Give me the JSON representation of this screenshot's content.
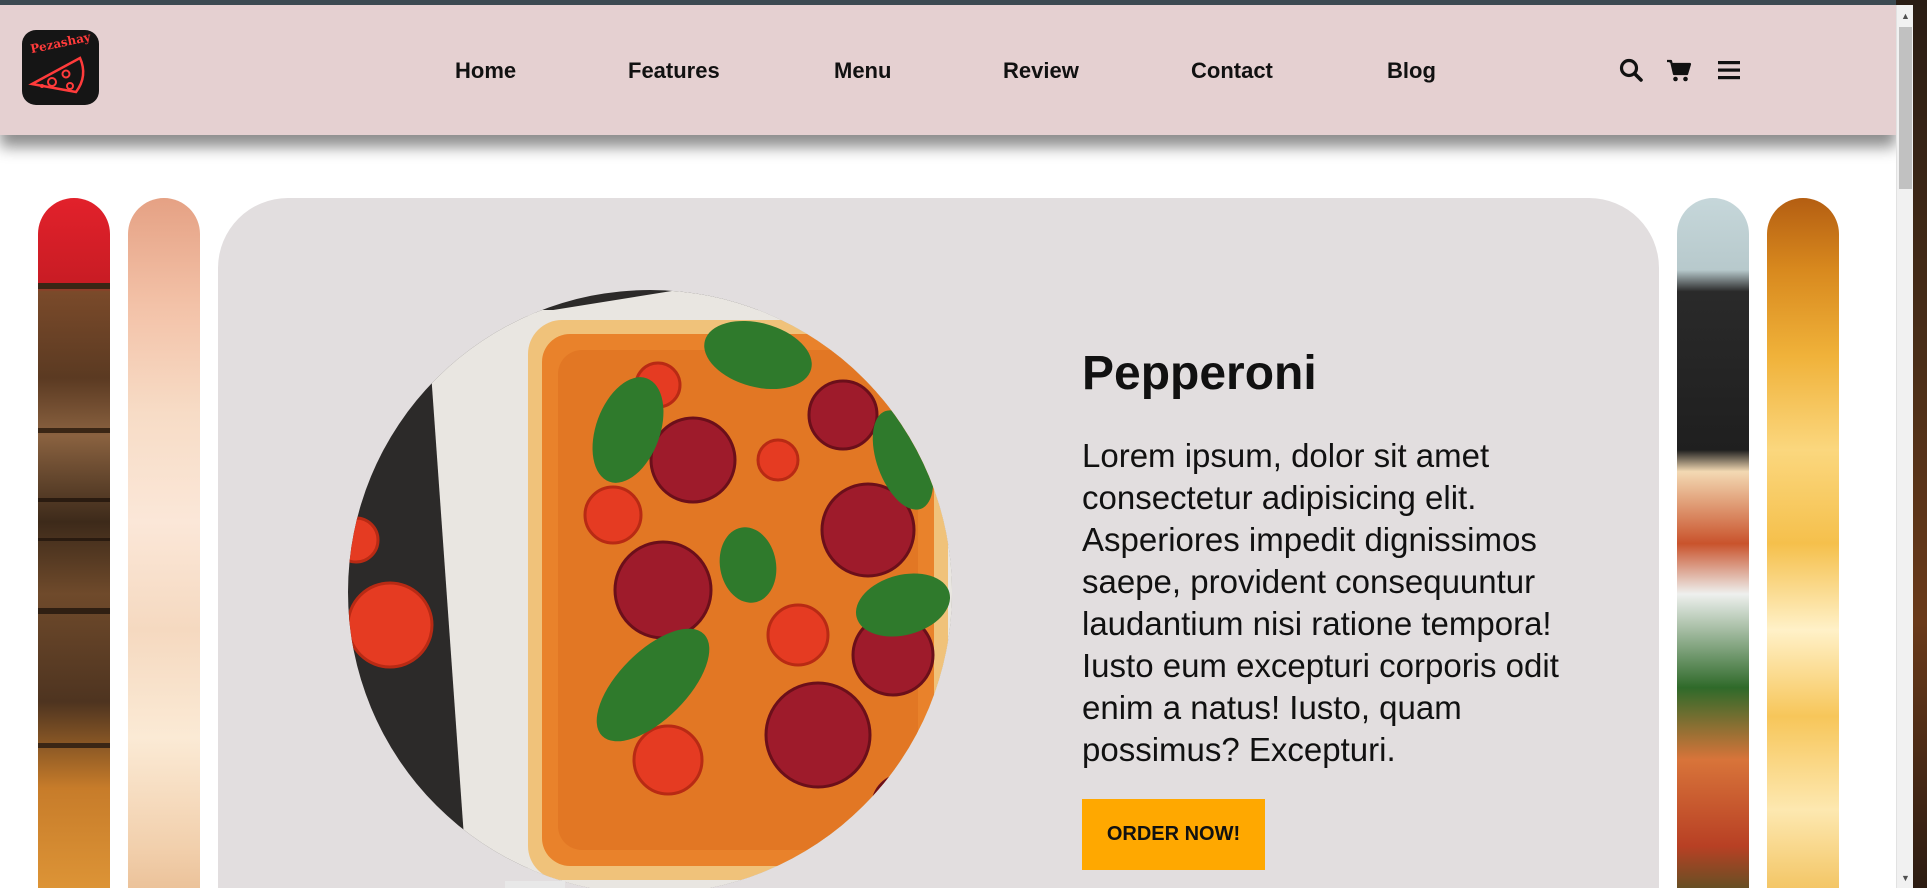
{
  "brand": {
    "logo_text": "Pezashay"
  },
  "nav": {
    "links": [
      "Home",
      "Features",
      "Menu",
      "Review",
      "Contact",
      "Blog"
    ],
    "icons": [
      "search-icon",
      "cart-icon",
      "menu-icon"
    ]
  },
  "hero": {
    "title": "Pepperoni",
    "description": "Lorem ipsum, dolor sit amet consectetur adipisicing elit. Asperiores impedit dignissimos saepe, provident consequuntur laudantium nisi ratione tempora! Iusto eum excepturi corporis odit enim a natus! Iusto, quam possimus? Excepturi.",
    "button_label": "ORDER NOW!"
  },
  "colors": {
    "header_bg": "#e5d0d1",
    "card_bg": "#e2dedf",
    "accent": "#ffa800"
  }
}
